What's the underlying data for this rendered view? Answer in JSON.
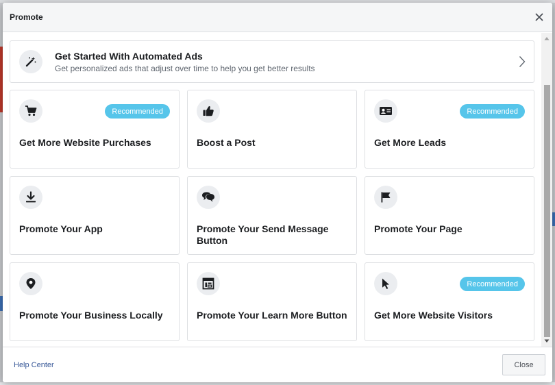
{
  "dialog": {
    "title": "Promote",
    "close_icon": "close-icon"
  },
  "automated_ads": {
    "icon": "magic-wand-icon",
    "title": "Get Started With Automated Ads",
    "subtitle": "Get personalized ads that adjust over time to help you get better results",
    "chevron_icon": "chevron-right-icon"
  },
  "cards": [
    {
      "label": "Get More Website Purchases",
      "icon": "shopping-cart-icon",
      "badge": "Recommended"
    },
    {
      "label": "Boost a Post",
      "icon": "thumbs-up-icon",
      "badge": ""
    },
    {
      "label": "Get More Leads",
      "icon": "contact-card-icon",
      "badge": "Recommended"
    },
    {
      "label": "Promote Your App",
      "icon": "download-icon",
      "badge": ""
    },
    {
      "label": "Promote Your Send Message Button",
      "icon": "chat-bubbles-icon",
      "badge": ""
    },
    {
      "label": "Promote Your Page",
      "icon": "flag-icon",
      "badge": ""
    },
    {
      "label": "Promote Your Business Locally",
      "icon": "location-pin-icon",
      "badge": ""
    },
    {
      "label": "Promote Your Learn More Button",
      "icon": "browser-window-icon",
      "badge": ""
    },
    {
      "label": "Get More Website Visitors",
      "icon": "cursor-icon",
      "badge": "Recommended"
    }
  ],
  "footer": {
    "help_label": "Help Center",
    "close_label": "Close"
  },
  "colors": {
    "badge": "#56c5ea",
    "link": "#385898",
    "title_text": "#1c1e21",
    "subtitle_text": "#606770",
    "icon_bg": "#ebedf0"
  }
}
